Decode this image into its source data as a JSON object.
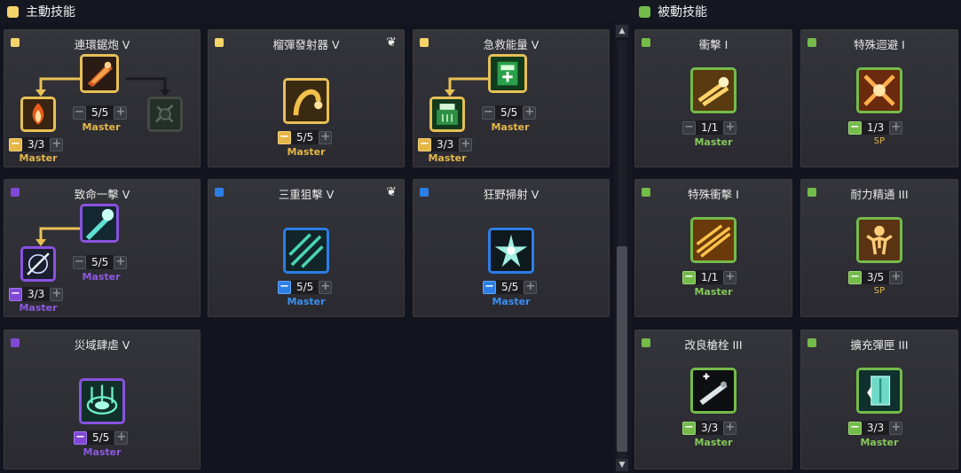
{
  "active": {
    "header": "主動技能",
    "color": "#f5d46a",
    "skills": [
      {
        "title": "連環鋸炮 V",
        "cat_color": "#f5d46a",
        "level": "5/5",
        "sub1_level": "3/3",
        "tag": "Master",
        "sub1_tag": "Master",
        "icon": "chain-saw-cannon-icon"
      },
      {
        "title": "榴彈發射器 V",
        "cat_color": "#f5d46a",
        "level": "5/5",
        "tag": "Master",
        "icon": "grenade-launcher-icon",
        "feather": "feather-icon"
      },
      {
        "title": "急救能量 V",
        "cat_color": "#f5d46a",
        "level": "5/5",
        "sub1_level": "3/3",
        "tag": "Master",
        "sub1_tag": "Master",
        "icon": "emergency-energy-icon"
      },
      {
        "title": "致命一擊 V",
        "cat_color": "#8048d4",
        "level": "5/5",
        "sub1_level": "3/3",
        "tag": "Master",
        "sub1_tag": "Master",
        "icon": "fatal-strike-icon"
      },
      {
        "title": "三重狙擊 V",
        "cat_color": "#2c7ee6",
        "level": "5/5",
        "tag": "Master",
        "icon": "triple-snipe-icon",
        "feather": "feather-icon"
      },
      {
        "title": "狂野掃射 V",
        "cat_color": "#2c7ee6",
        "level": "5/5",
        "tag": "Master",
        "icon": "wild-strafe-icon"
      },
      {
        "title": "災域肆虐 V",
        "cat_color": "#8048d4",
        "level": "5/5",
        "tag": "Master",
        "icon": "disaster-zone-icon"
      }
    ]
  },
  "passive": {
    "header": "被動技能",
    "color": "#74bb4a",
    "skills": [
      {
        "title": "衝擊 I",
        "level": "1/1",
        "tag": "Master",
        "icon": "impact-icon"
      },
      {
        "title": "特殊迴避 I",
        "level": "1/3",
        "tag": "SP",
        "icon": "special-evade-icon"
      },
      {
        "title": "特殊衝擊 I",
        "level": "1/1",
        "tag": "Master",
        "icon": "special-impact-icon"
      },
      {
        "title": "耐力精通 III",
        "level": "3/5",
        "tag": "SP",
        "icon": "stamina-mastery-icon"
      },
      {
        "title": "改良槍栓 III",
        "level": "3/3",
        "tag": "Master",
        "icon": "improved-bolt-icon"
      },
      {
        "title": "擴充彈匣 III",
        "level": "3/3",
        "tag": "Master",
        "icon": "extended-magazine-icon"
      }
    ]
  },
  "scrollbar": {
    "up": "▲",
    "down": "▼"
  }
}
